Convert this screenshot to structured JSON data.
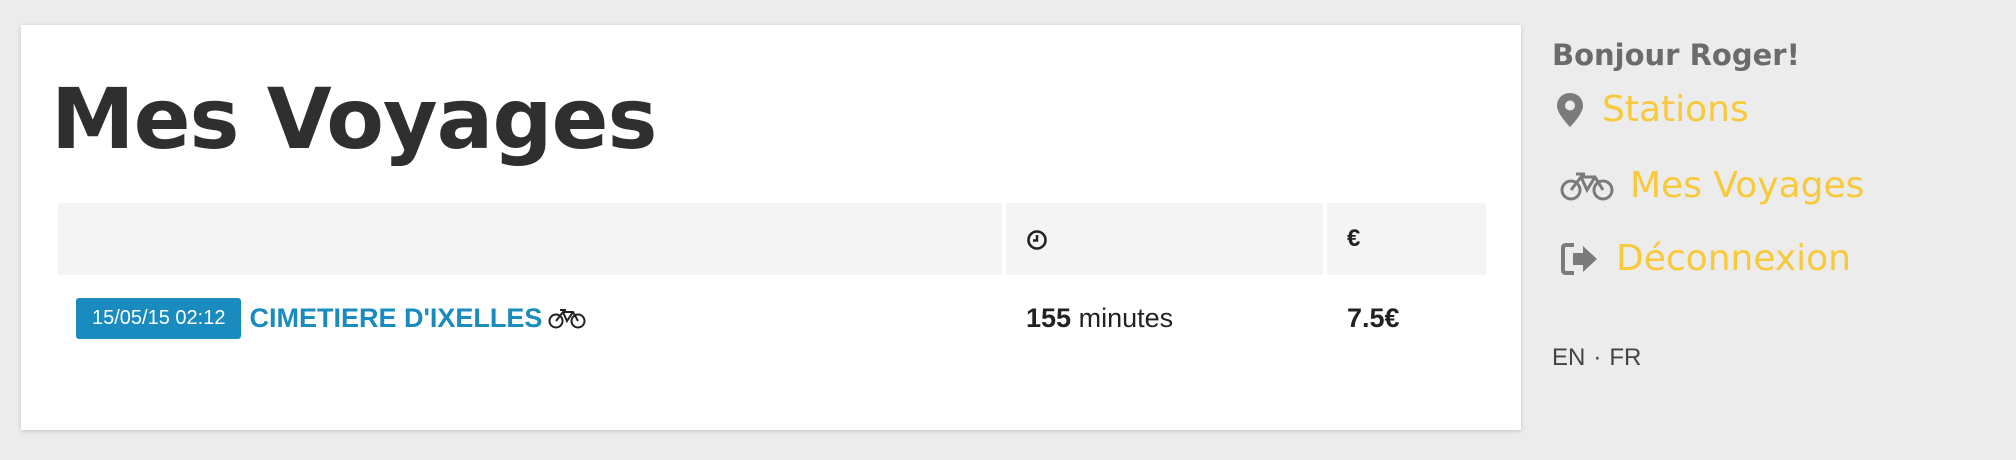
{
  "main": {
    "title": "Mes Voyages",
    "table": {
      "columns": [
        {
          "label": "",
          "icon": ""
        },
        {
          "label": "",
          "icon": "clock-icon"
        },
        {
          "label": "€",
          "icon": "euro-symbol"
        }
      ],
      "rows": [
        {
          "date": "15/05/15 02:12",
          "station": "CIMETIERE D'IXELLES",
          "icon": "bicycle-icon",
          "duration_value": "155",
          "duration_unit": "minutes",
          "price": "7.5€"
        }
      ]
    }
  },
  "sidebar": {
    "greeting": "Bonjour Roger!",
    "nav": [
      {
        "label": "Stations",
        "icon": "map-marker-icon"
      },
      {
        "label": "Mes Voyages",
        "icon": "bicycle-icon"
      },
      {
        "label": "Déconnexion",
        "icon": "sign-out-icon"
      }
    ],
    "languages": [
      "EN",
      "FR"
    ],
    "language_separator": "·"
  },
  "colors": {
    "background": "#ececec",
    "accent_blue": "#1a8bbf",
    "nav_yellow": "#f8c93a",
    "title_dark": "#2f2f2f",
    "greeting_gray": "#6b6b6b"
  }
}
